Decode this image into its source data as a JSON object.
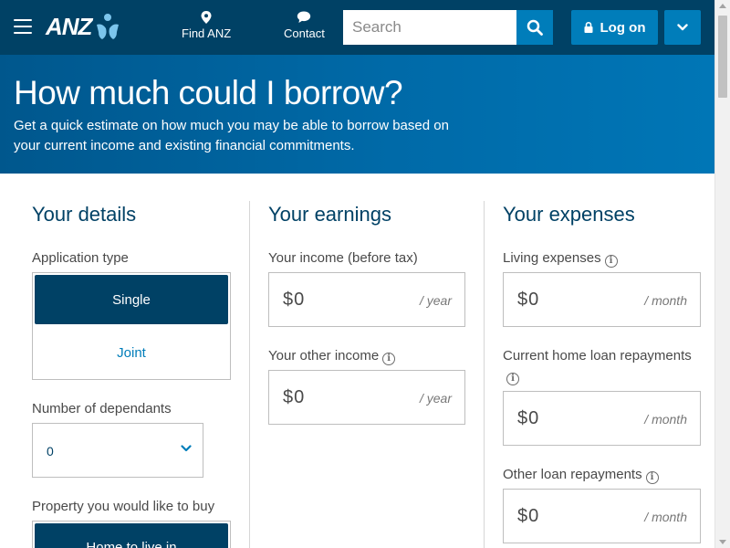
{
  "header": {
    "brand": "ANZ",
    "nav": [
      {
        "label": "Find ANZ",
        "icon": "location-pin-icon"
      },
      {
        "label": "Contact",
        "icon": "chat-bubble-icon"
      }
    ],
    "search_placeholder": "Search",
    "logon_label": "Log on"
  },
  "hero": {
    "title": "How much could I borrow?",
    "subtitle": "Get a quick estimate on how much you may be able to borrow based on your current income and existing financial commitments."
  },
  "details": {
    "title": "Your details",
    "application_type_label": "Application type",
    "application_type_options": [
      "Single",
      "Joint"
    ],
    "application_type_selected": "Single",
    "dependants_label": "Number of dependants",
    "dependants_value": "0",
    "property_label": "Property you would like to buy",
    "property_option_visible": "Home to live in"
  },
  "earnings": {
    "title": "Your earnings",
    "income_label": "Your income (before tax)",
    "income_value": "$0",
    "income_unit": "/ year",
    "other_income_label": "Your other income",
    "other_income_value": "$0",
    "other_income_unit": "/ year"
  },
  "expenses": {
    "title": "Your expenses",
    "living_label": "Living expenses",
    "living_value": "$0",
    "living_unit": "/ month",
    "home_loan_label": "Current home loan repayments",
    "home_loan_value": "$0",
    "home_loan_unit": "/ month",
    "other_loan_label": "Other loan repayments",
    "other_loan_value": "$0",
    "other_loan_unit": "/ month"
  },
  "colors": {
    "header_bg": "#004165",
    "accent": "#007dba",
    "selected_toggle": "#004165",
    "heading": "#004165"
  }
}
